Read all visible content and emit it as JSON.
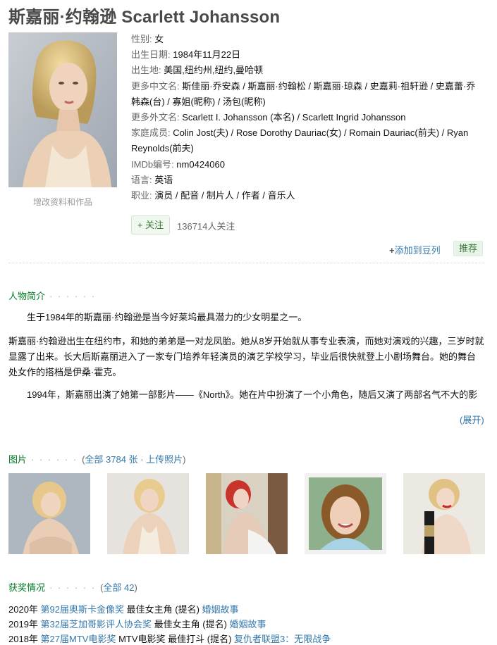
{
  "title": "斯嘉丽·约翰逊 Scarlett Johansson",
  "portrait_edit": "增改资料和作品",
  "info": {
    "gender": {
      "label": "性别",
      "value": "女"
    },
    "birthday": {
      "label": "出生日期",
      "value": "1984年11月22日"
    },
    "birthplace": {
      "label": "出生地",
      "value": "美国,纽约州,纽约,曼哈顿"
    },
    "cn_names": {
      "label": "更多中文名",
      "value": "斯佳丽·乔安森 / 斯嘉丽·约翰松 / 斯嘉丽·琼森 / 史嘉莉·祖轩逊 / 史嘉蕾·乔韩森(台) / 寡姐(昵称) / 汤包(昵称)"
    },
    "foreign_names": {
      "label": "更多外文名",
      "value": "Scarlett I. Johansson (本名) / Scarlett Ingrid Johansson"
    },
    "family": {
      "label": "家庭成员",
      "value": "Colin Jost(夫) / Rose Dorothy Dauriac(女) / Romain Dauriac(前夫) / Ryan Reynolds(前夫)"
    },
    "imdb": {
      "label": "IMDb编号",
      "value": "nm0424060"
    },
    "language": {
      "label": "语言",
      "value": "英语"
    },
    "occupation": {
      "label": "职业",
      "value": "演员 / 配音 / 制片人 / 作者 / 音乐人"
    },
    "separator": ": "
  },
  "follow": {
    "button": "+ 关注",
    "count": "136714人关注"
  },
  "add_doulist": {
    "plus": "+",
    "label": "添加到豆列"
  },
  "recommend": "推荐",
  "bio_section": {
    "title": "人物简介",
    "dots": "· · · · · ·",
    "paragraphs": [
      "生于1984年的斯嘉丽·约翰逊是当今好莱坞最具潜力的少女明星之一。",
      "斯嘉丽·约翰逊出生在纽约市，和她的弟弟是一对龙凤胎。她从8岁开始就从事专业表演，而她对演戏的兴趣，三岁时就显露了出来。长大后斯嘉丽进入了一家专门培养年轻演员的演艺学校学习，毕业后很快就登上小剧场舞台。她的舞台处女作的搭档是伊桑·霍克。",
      "1994年，斯嘉丽出演了她第一部影片——《North》。她在片中扮演了一个小角色，随后又演了两部名气不大的影"
    ],
    "expand": "(展开)"
  },
  "photos_section": {
    "title": "图片",
    "dots": "· · · · · ·",
    "open": "(",
    "all": "全部 3784 张",
    "sep": " · ",
    "upload": "上传照片",
    "close": ")"
  },
  "awards_section": {
    "title": "获奖情况",
    "dots": "· · · · · ·",
    "open": "(",
    "all": "全部 42",
    "close": ")",
    "items": [
      {
        "year": "2020年",
        "ceremony": "第92届奥斯卡金像奖",
        "category": "最佳女主角 (提名)",
        "work": "婚姻故事"
      },
      {
        "year": "2019年",
        "ceremony": "第32届芝加哥影评人协会奖",
        "category": "最佳女主角 (提名)",
        "work": "婚姻故事"
      },
      {
        "year": "2018年",
        "ceremony": "第27届MTV电影奖",
        "category": "MTV电影奖 最佳打斗 (提名)",
        "work": "复仇者联盟3：无限战争"
      }
    ]
  },
  "colors": {
    "green": "#007722",
    "link": "#3377aa",
    "muted": "#666666"
  }
}
